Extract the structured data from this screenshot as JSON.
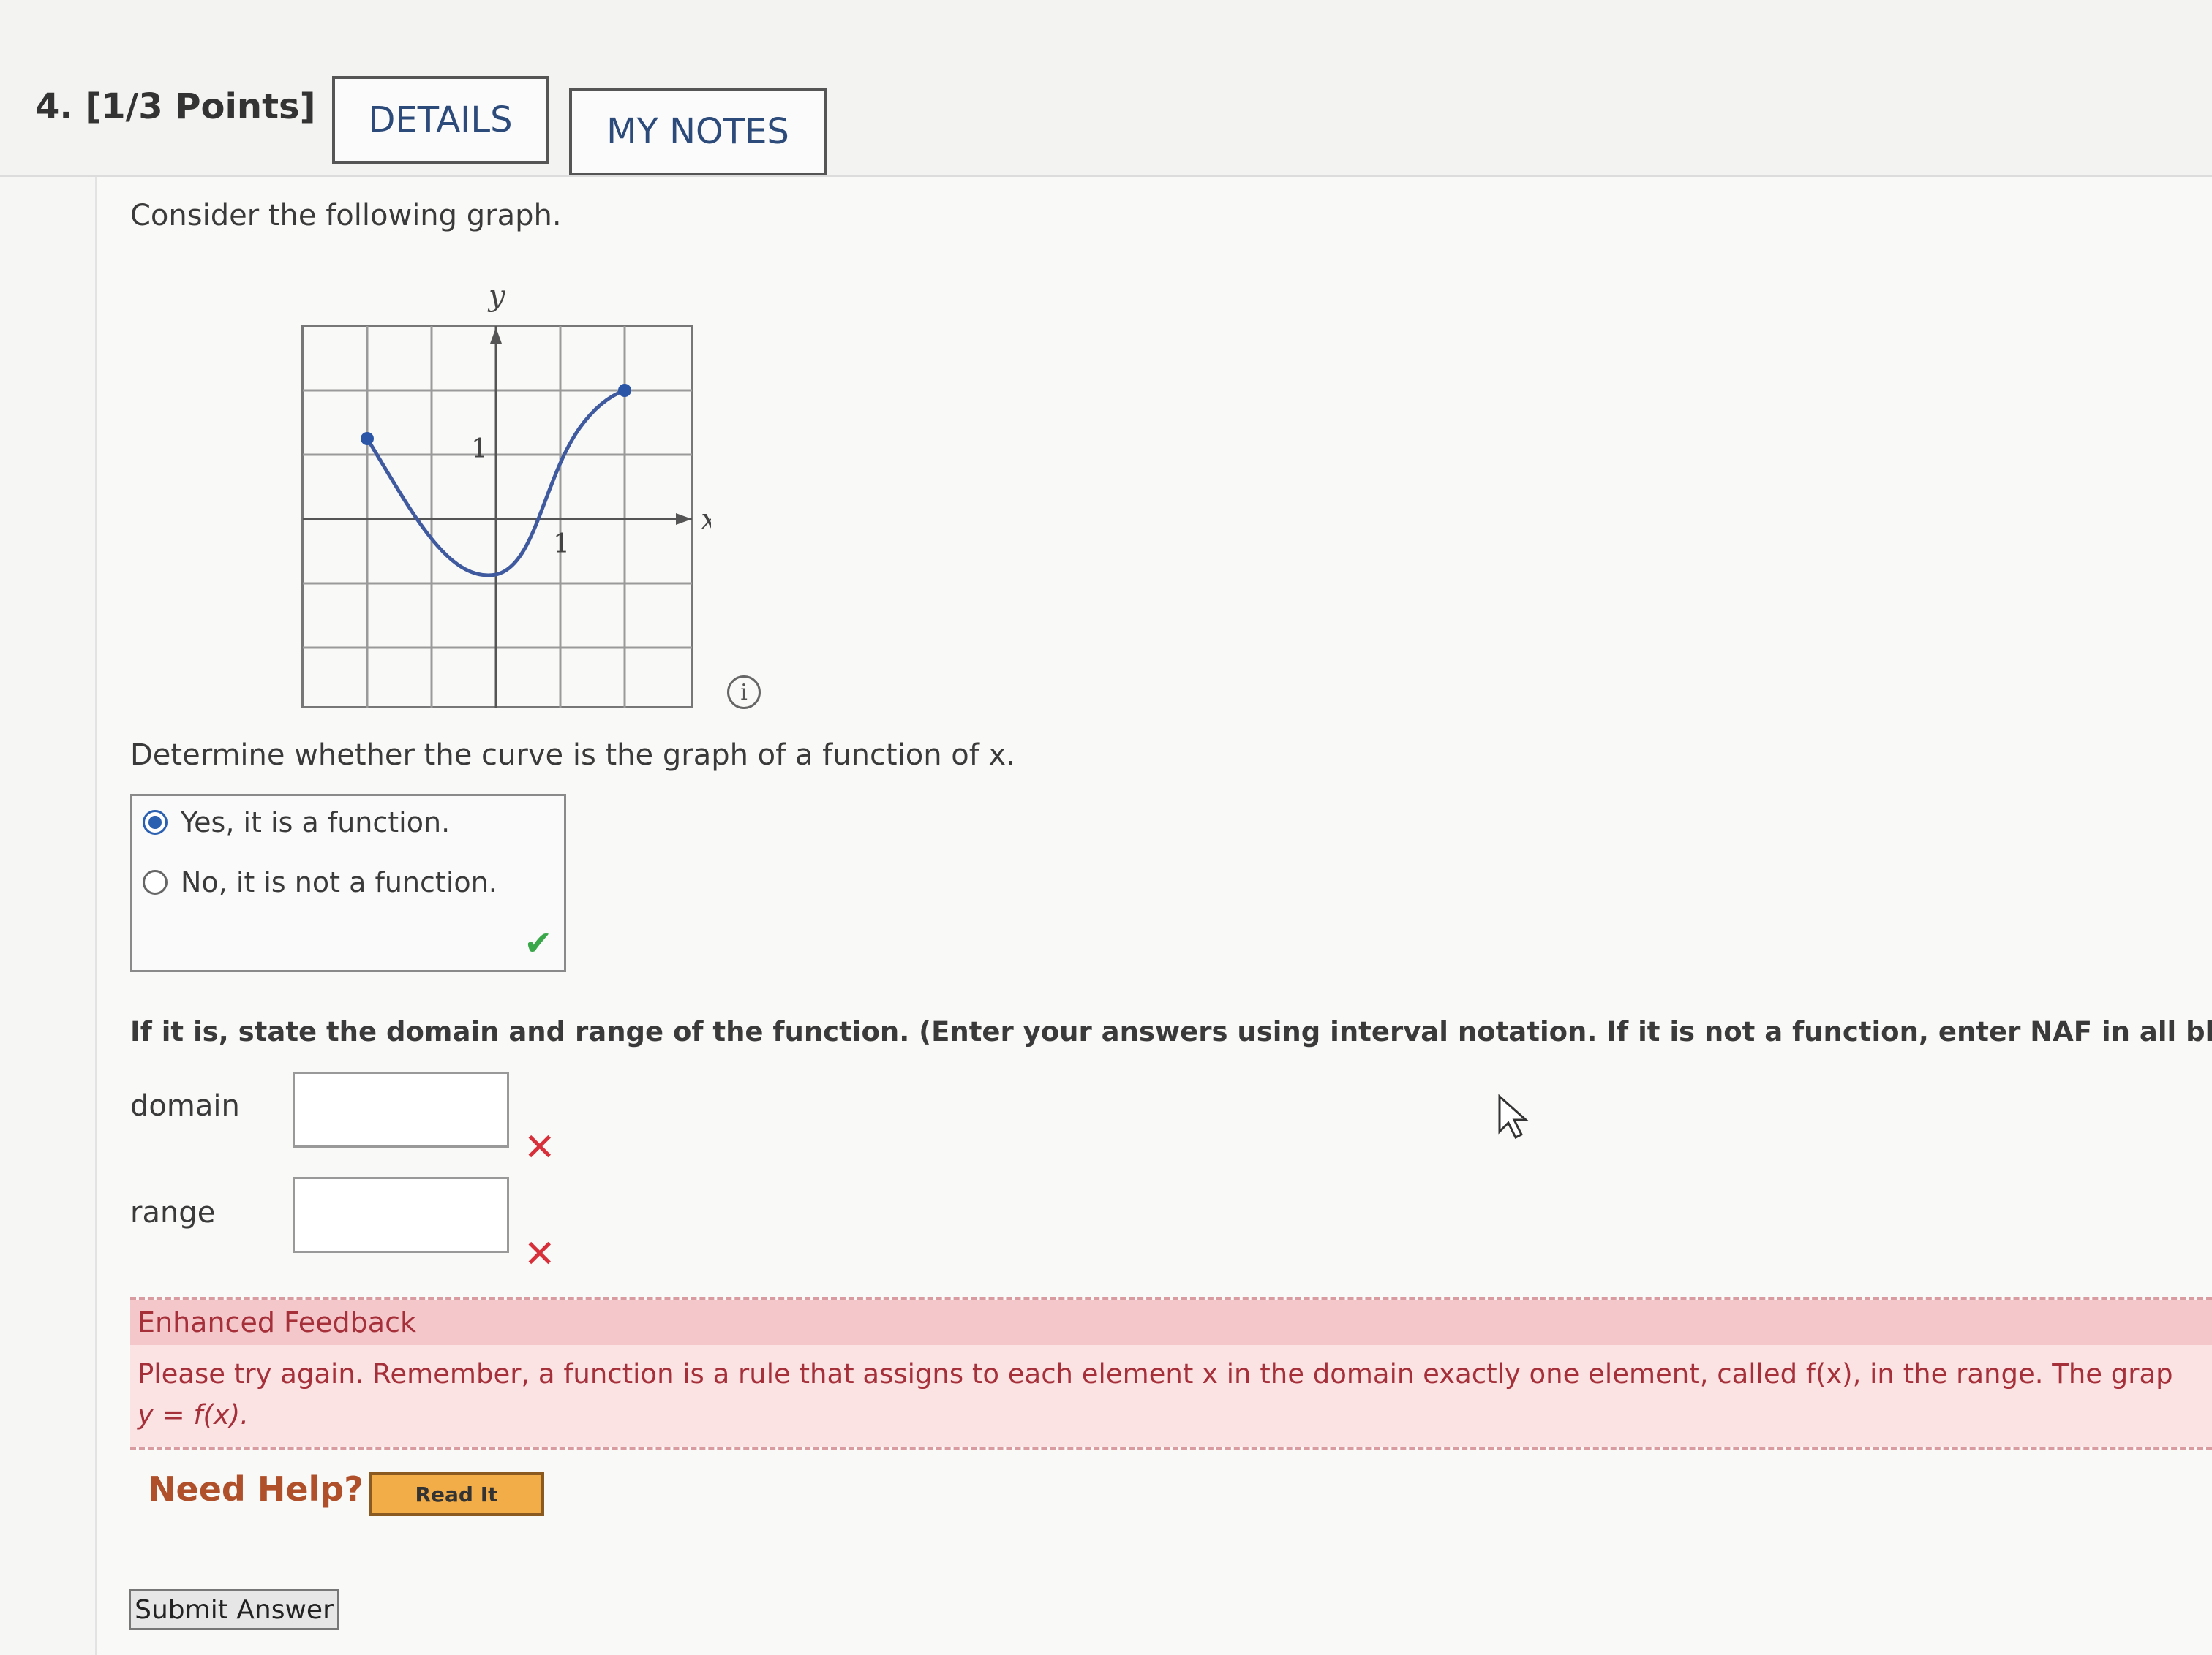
{
  "question": {
    "number_points": "4. [1/3 Points]",
    "details_label": "DETAILS",
    "my_notes_label": "MY NOTES"
  },
  "prompt": "Consider the following graph.",
  "graph": {
    "y_label": "y",
    "x_label": "x",
    "tick_label_y": "1",
    "tick_label_x": "1",
    "info_icon_glyph": "i"
  },
  "part1": {
    "question": "Determine whether the curve is the graph of a function of x.",
    "options": [
      {
        "label": "Yes, it is a function.",
        "selected": true
      },
      {
        "label": "No, it is not a function.",
        "selected": false
      }
    ],
    "status": "correct"
  },
  "part2": {
    "instructions": "If it is, state the domain and range of the function. (Enter your answers using interval notation. If it is not a function, enter NAF in all blanks.)",
    "domain_label": "domain",
    "domain_value": "",
    "range_label": "range",
    "range_value": "",
    "domain_status": "incorrect",
    "range_status": "incorrect"
  },
  "feedback": {
    "title": "Enhanced Feedback",
    "body": "Please try again. Remember, a function is a rule that assigns to each element x in the domain exactly one element, called f(x), in the range. The grap",
    "body_line2": "y = f(x)."
  },
  "help": {
    "need_help": "Need Help?",
    "read_it": "Read It"
  },
  "submit_label": "Submit Answer",
  "colors": {
    "curve": "#3f5a9e",
    "point": "#2b56a8",
    "correct": "#3aa84a",
    "incorrect": "#d8303a",
    "feedback_bg": "#f4c8cb",
    "accent_button": "#f2ad48"
  }
}
